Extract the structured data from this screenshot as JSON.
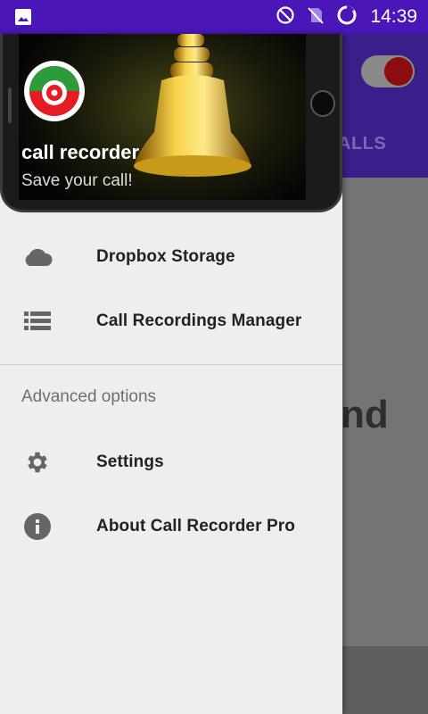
{
  "status_bar": {
    "time": "14:39",
    "left_icon": "image-icon",
    "right_icons": [
      "do-not-disturb-icon",
      "no-sim-icon",
      "sync-icon"
    ]
  },
  "app_background": {
    "tab_partial": "ALLS",
    "big_text_partial": "nd",
    "toggle_on": true
  },
  "drawer": {
    "header": {
      "title": "call recorder",
      "subtitle": "Save your call!"
    },
    "items": [
      {
        "label": "Dropbox Storage",
        "icon": "cloud-icon"
      },
      {
        "label": "Call Recordings Manager",
        "icon": "list-icon"
      }
    ],
    "section_title": "Advanced options",
    "advanced_items": [
      {
        "label": "Settings",
        "icon": "gear-icon"
      },
      {
        "label": "About Call Recorder Pro",
        "icon": "info-icon"
      }
    ]
  },
  "colors": {
    "status_bar": "#4a16b8",
    "drawer_bg": "#eeeeee",
    "icon_gray": "#666666"
  }
}
